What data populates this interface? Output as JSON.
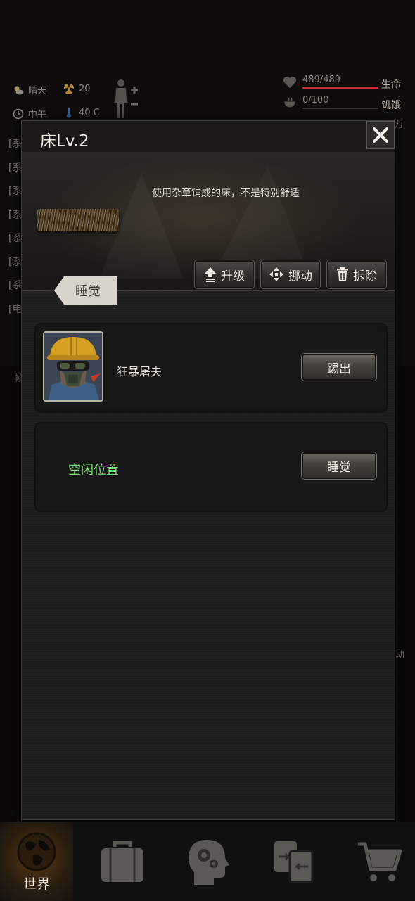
{
  "hud": {
    "weather": "晴天",
    "radiation": "20",
    "time_of_day": "中午",
    "temperature": "40 C",
    "stats": [
      {
        "value": "489/489",
        "label": "生命",
        "fill": 1.0,
        "color": "#c03030"
      },
      {
        "value": "0/100",
        "label": "饥饿",
        "fill": 0.0,
        "color": "#777"
      }
    ],
    "partial_third_label": "力",
    "log_prefixes": [
      "[系",
      "[系",
      "[系",
      "[系",
      "[系",
      "[系",
      "[系",
      "[电"
    ],
    "side_fragment_1": "帧",
    "side_fragment_2": "动"
  },
  "dialog": {
    "title": "床Lv.2",
    "description": "使用杂草铺成的床，不是特别舒适",
    "actions": [
      {
        "label": "升级",
        "icon": "upgrade-arrow-icon"
      },
      {
        "label": "挪动",
        "icon": "move-arrows-icon"
      },
      {
        "label": "拆除",
        "icon": "trash-icon"
      }
    ],
    "tab_label": "睡觉",
    "slots": [
      {
        "occupant": "狂暴屠夫",
        "button": "踢出"
      },
      {
        "empty_text": "空闲位置",
        "button": "睡觉"
      }
    ]
  },
  "nav": {
    "items": [
      {
        "label": "世界",
        "icon": "globe-icon",
        "active": true
      },
      {
        "label": "",
        "icon": "briefcase-icon"
      },
      {
        "label": "",
        "icon": "head-gears-icon"
      },
      {
        "label": "",
        "icon": "swap-cards-icon"
      },
      {
        "label": "",
        "icon": "shopping-cart-icon"
      }
    ]
  }
}
